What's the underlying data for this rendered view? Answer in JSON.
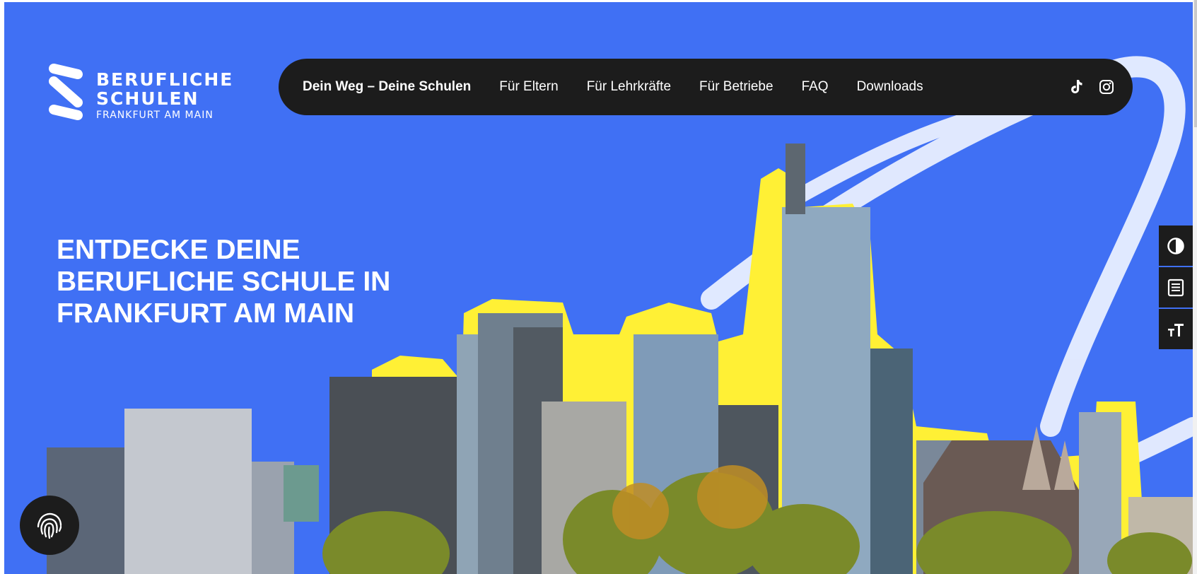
{
  "logo": {
    "line1": "BERUFLICHE",
    "line2": "SCHULEN",
    "line3": "FRANKFURT AM MAIN"
  },
  "nav": {
    "items": [
      {
        "label": "Dein Weg – Deine Schulen",
        "active": true
      },
      {
        "label": "Für Eltern",
        "active": false
      },
      {
        "label": "Für Lehrkräfte",
        "active": false
      },
      {
        "label": "Für Betriebe",
        "active": false
      },
      {
        "label": "FAQ",
        "active": false
      },
      {
        "label": "Downloads",
        "active": false
      }
    ],
    "social": [
      {
        "icon": "tiktok-icon"
      },
      {
        "icon": "instagram-icon"
      }
    ]
  },
  "hero": {
    "headline_lines": [
      "ENTDECKE DEINE",
      "BERUFLICHE SCHULE IN",
      "FRANKFURT AM MAIN"
    ]
  },
  "side_tools": [
    {
      "icon": "contrast-icon"
    },
    {
      "icon": "reader-icon"
    },
    {
      "icon": "text-size-icon"
    }
  ],
  "cookie_button": {
    "icon": "fingerprint-icon"
  },
  "colors": {
    "background": "#4070f4",
    "nav": "#1c1c1c",
    "highlight": "#fff035",
    "text": "#ffffff"
  }
}
